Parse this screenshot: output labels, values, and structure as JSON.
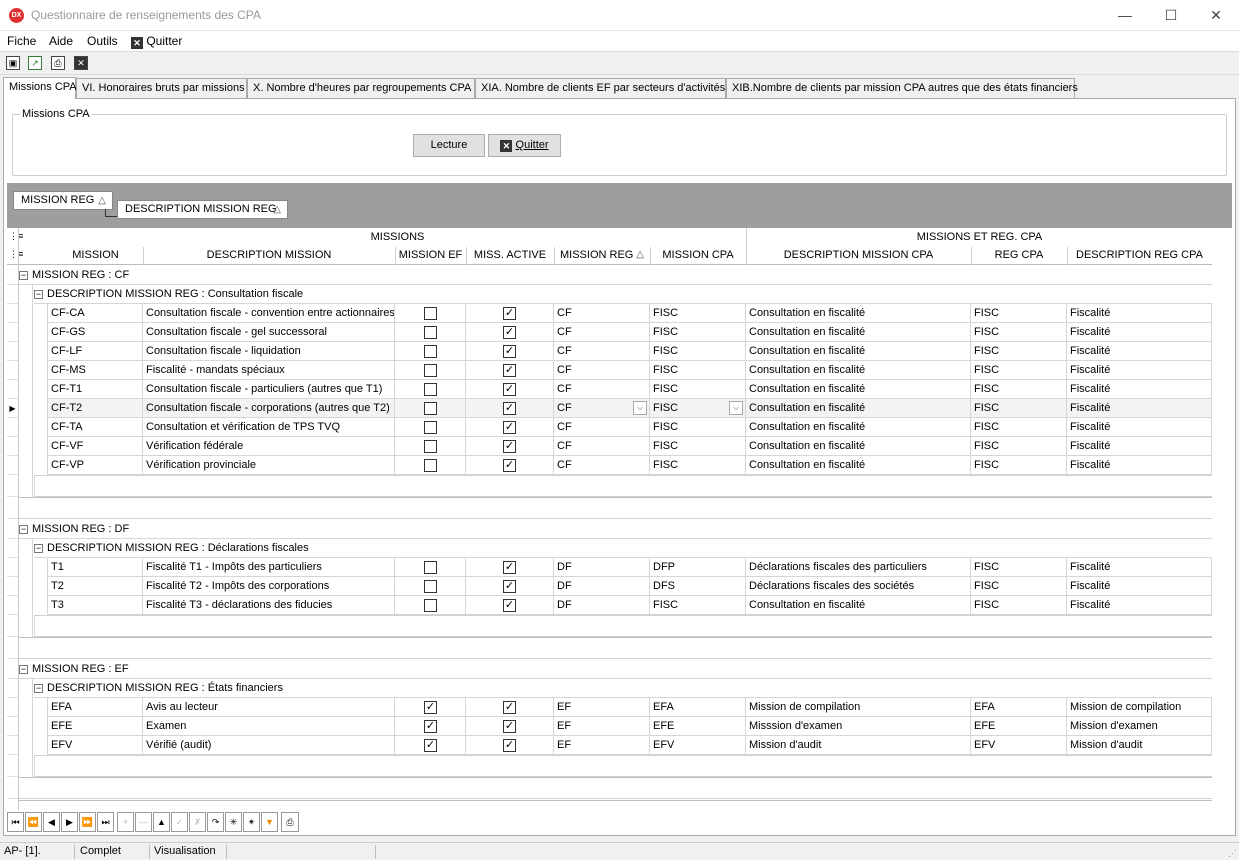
{
  "window": {
    "title": "Questionnaire de renseignements des CPA",
    "app_icon": "DX"
  },
  "menu": {
    "items": [
      "Fiche",
      "Aide",
      "Outils"
    ],
    "quit": "Quitter"
  },
  "tabs": [
    "Missions CPA",
    "VI. Honoraires bruts par missions",
    "X. Nombre d'heures par regroupements CPA",
    "XIA. Nombre de clients EF par secteurs d'activités",
    "XIB.Nombre de clients par mission CPA autres que des états financiers"
  ],
  "groupbox": {
    "title": "Missions CPA",
    "read_button": "Lecture",
    "quit_button": "Quitter"
  },
  "grouping": {
    "level1": "MISSION REG",
    "level2": "DESCRIPTION MISSION REG",
    "sort_icon": "sort-asc-icon"
  },
  "bands": {
    "missions": "MISSIONS",
    "reg": "MISSIONS ET REG. CPA"
  },
  "columns": [
    "MISSION",
    "DESCRIPTION MISSION",
    "MISSION EF",
    "MISS. ACTIVE",
    "MISSION REG",
    "MISSION CPA",
    "DESCRIPTION MISSION CPA",
    "REG CPA",
    "DESCRIPTION REG CPA"
  ],
  "groups": [
    {
      "header": "MISSION REG : CF",
      "subheader": "DESCRIPTION MISSION REG : Consultation fiscale",
      "rows": [
        {
          "mission": "CF-CA",
          "desc": "Consultation fiscale - convention entre actionnaires",
          "ef": false,
          "active": true,
          "reg": "CF",
          "cpa": "FISC",
          "desc_cpa": "Consultation en fiscalité",
          "reg_cpa": "FISC",
          "desc_reg": "Fiscalité"
        },
        {
          "mission": "CF-GS",
          "desc": "Consultation fiscale - gel successoral",
          "ef": false,
          "active": true,
          "reg": "CF",
          "cpa": "FISC",
          "desc_cpa": "Consultation en fiscalité",
          "reg_cpa": "FISC",
          "desc_reg": "Fiscalité"
        },
        {
          "mission": "CF-LF",
          "desc": "Consultation fiscale - liquidation",
          "ef": false,
          "active": true,
          "reg": "CF",
          "cpa": "FISC",
          "desc_cpa": "Consultation en fiscalité",
          "reg_cpa": "FISC",
          "desc_reg": "Fiscalité"
        },
        {
          "mission": "CF-MS",
          "desc": "Fiscalité - mandats spéciaux",
          "ef": false,
          "active": true,
          "reg": "CF",
          "cpa": "FISC",
          "desc_cpa": "Consultation en fiscalité",
          "reg_cpa": "FISC",
          "desc_reg": "Fiscalité"
        },
        {
          "mission": "CF-T1",
          "desc": "Consultation fiscale - particuliers (autres que T1)",
          "ef": false,
          "active": true,
          "reg": "CF",
          "cpa": "FISC",
          "desc_cpa": "Consultation en fiscalité",
          "reg_cpa": "FISC",
          "desc_reg": "Fiscalité"
        },
        {
          "mission": "CF-T2",
          "desc": "Consultation fiscale - corporations (autres que T2)",
          "ef": false,
          "active": true,
          "reg": "CF",
          "cpa": "FISC",
          "desc_cpa": "Consultation en fiscalité",
          "reg_cpa": "FISC",
          "desc_reg": "Fiscalité",
          "selected": true
        },
        {
          "mission": "CF-TA",
          "desc": "Consultation et vérification de TPS TVQ",
          "ef": false,
          "active": true,
          "reg": "CF",
          "cpa": "FISC",
          "desc_cpa": "Consultation en fiscalité",
          "reg_cpa": "FISC",
          "desc_reg": "Fiscalité"
        },
        {
          "mission": "CF-VF",
          "desc": "Vérification fédérale",
          "ef": false,
          "active": true,
          "reg": "CF",
          "cpa": "FISC",
          "desc_cpa": "Consultation en fiscalité",
          "reg_cpa": "FISC",
          "desc_reg": "Fiscalité"
        },
        {
          "mission": "CF-VP",
          "desc": "Vérification provinciale",
          "ef": false,
          "active": true,
          "reg": "CF",
          "cpa": "FISC",
          "desc_cpa": "Consultation en fiscalité",
          "reg_cpa": "FISC",
          "desc_reg": "Fiscalité"
        }
      ]
    },
    {
      "header": "MISSION REG : DF",
      "subheader": "DESCRIPTION MISSION REG : Déclarations fiscales",
      "rows": [
        {
          "mission": "T1",
          "desc": "Fiscalité T1 - Impôts des particuliers",
          "ef": false,
          "active": true,
          "reg": "DF",
          "cpa": "DFP",
          "desc_cpa": "Déclarations fiscales des particuliers",
          "reg_cpa": "FISC",
          "desc_reg": "Fiscalité"
        },
        {
          "mission": "T2",
          "desc": "Fiscalité T2 - Impôts des corporations",
          "ef": false,
          "active": true,
          "reg": "DF",
          "cpa": "DFS",
          "desc_cpa": "Déclarations fiscales des sociétés",
          "reg_cpa": "FISC",
          "desc_reg": "Fiscalité"
        },
        {
          "mission": "T3",
          "desc": "Fiscalité T3 - déclarations des fiducies",
          "ef": false,
          "active": true,
          "reg": "DF",
          "cpa": "FISC",
          "desc_cpa": "Consultation en fiscalité",
          "reg_cpa": "FISC",
          "desc_reg": "Fiscalité"
        }
      ]
    },
    {
      "header": "MISSION REG : EF",
      "subheader": "DESCRIPTION MISSION REG : États financiers",
      "rows": [
        {
          "mission": "EFA",
          "desc": "Avis au lecteur",
          "ef": true,
          "active": true,
          "reg": "EF",
          "cpa": "EFA",
          "desc_cpa": "Mission de compilation",
          "reg_cpa": "EFA",
          "desc_reg": "Mission de compilation"
        },
        {
          "mission": "EFE",
          "desc": "Examen",
          "ef": true,
          "active": true,
          "reg": "EF",
          "cpa": "EFE",
          "desc_cpa": "Misssion d'examen",
          "reg_cpa": "EFE",
          "desc_reg": "Mission d'examen"
        },
        {
          "mission": "EFV",
          "desc": "Vérifié (audit)",
          "ef": true,
          "active": true,
          "reg": "EF",
          "cpa": "EFV",
          "desc_cpa": "Mission d'audit",
          "reg_cpa": "EFV",
          "desc_reg": "Mission d'audit"
        }
      ]
    }
  ],
  "status": {
    "record": "AP- [1].",
    "state": "Complet",
    "mode": "Visualisation"
  },
  "colors": {
    "accent": "#e03131",
    "group_area": "#9e9e9e",
    "filter": "#f08c00"
  }
}
